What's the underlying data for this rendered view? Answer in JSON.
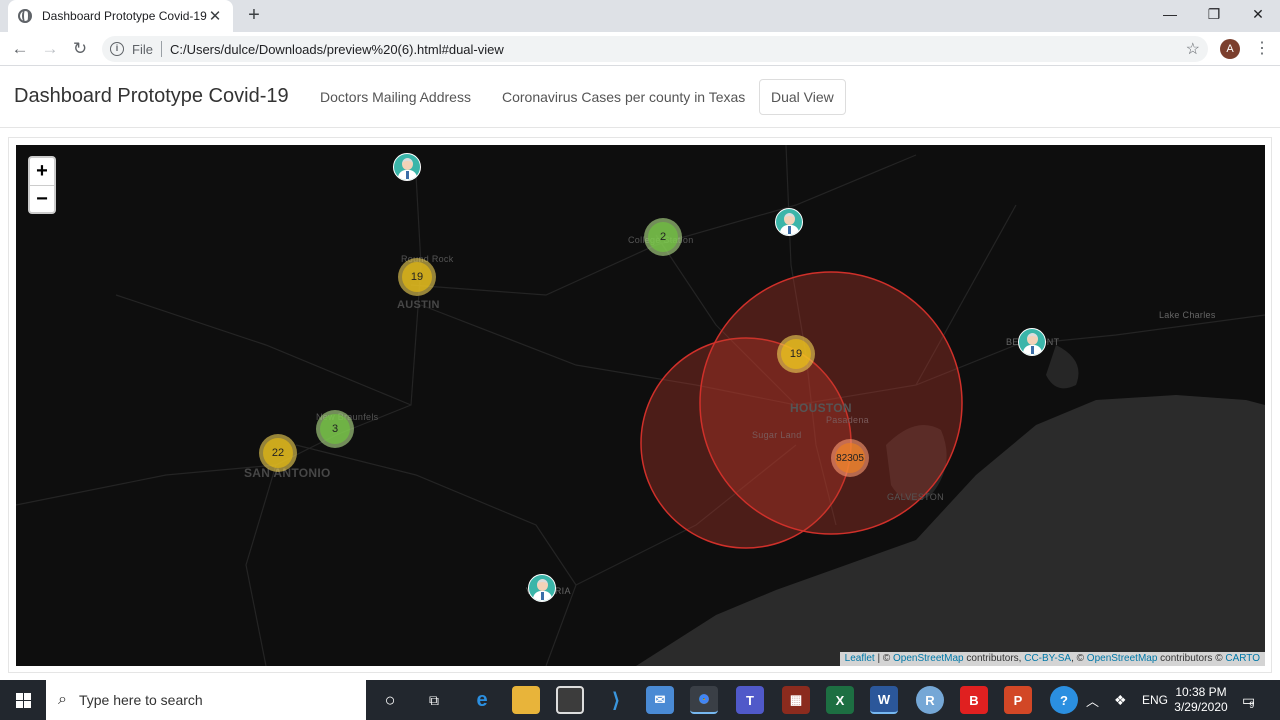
{
  "browser": {
    "tab_title": "Dashboard Prototype Covid-19",
    "tab_close": "✕",
    "new_tab": "+",
    "url_scheme": "File",
    "url": "C:/Users/dulce/Downloads/preview%20(6).html#dual-view",
    "profile_initial": "A",
    "window_controls": {
      "minimize": "—",
      "restore": "❐",
      "close": "✕"
    }
  },
  "navbar": {
    "brand": "Dashboard Prototype Covid-19",
    "links": [
      {
        "label": "Doctors Mailing Address",
        "active": false
      },
      {
        "label": "Coronavirus Cases per county in Texas",
        "active": false
      },
      {
        "label": "Dual View",
        "active": true
      }
    ]
  },
  "map": {
    "zoom_in": "+",
    "zoom_out": "−",
    "clusters": [
      {
        "count": "19",
        "color": "yellow"
      },
      {
        "count": "2",
        "color": "green"
      },
      {
        "count": "3",
        "color": "green"
      },
      {
        "count": "22",
        "color": "yellow"
      },
      {
        "count": "19",
        "color": "yellow"
      },
      {
        "count": "82305",
        "color": "orange"
      }
    ],
    "cities": [
      {
        "name": "Round Rock"
      },
      {
        "name": "AUSTIN"
      },
      {
        "name": "New Braunfels"
      },
      {
        "name": "SAN ANTONIO"
      },
      {
        "name": "College Station"
      },
      {
        "name": "HOUSTON"
      },
      {
        "name": "Pasadena"
      },
      {
        "name": "Sugar Land"
      },
      {
        "name": "GALVESTON"
      },
      {
        "name": "BEAUMONT"
      },
      {
        "name": "Lake Charles"
      },
      {
        "name": "VICTORIA"
      }
    ],
    "doctor_markers": 4,
    "attribution": {
      "leaflet": "Leaflet",
      "sep1": " | © ",
      "osm": "OpenStreetMap",
      "contributors": " contributors, ",
      "license": "CC-BY-SA",
      "sep2": ", © ",
      "osm2": "OpenStreetMap",
      "contributors2": " contributors © ",
      "carto": "CARTO"
    }
  },
  "taskbar": {
    "search_placeholder": "Type here to search",
    "language": "ENG",
    "time": "10:38 PM",
    "date": "3/29/2020",
    "notification_count": "9"
  },
  "colors": {
    "map_bg": "#0e0e0e",
    "water": "#2b2b2b",
    "case_circle": "#c0392b",
    "doctor_marker": "#3bb5a9"
  }
}
